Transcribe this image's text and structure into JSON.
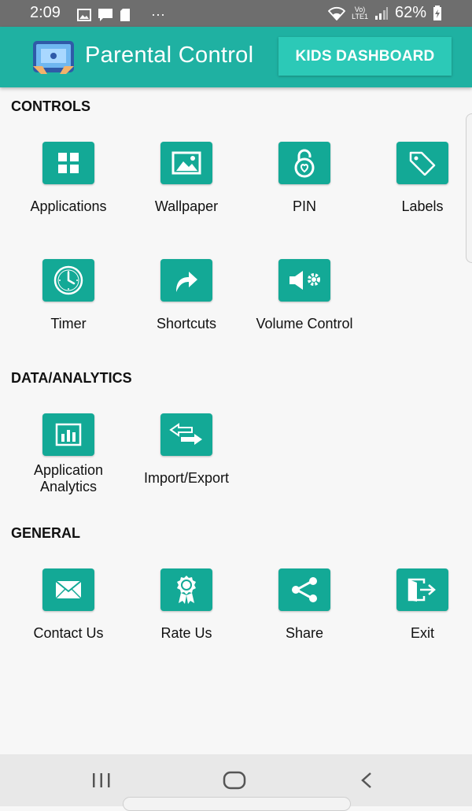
{
  "status_bar": {
    "time": "2:09",
    "more": "···",
    "network_top": "Vo)",
    "network_bottom": "LTE1",
    "battery": "62%"
  },
  "app_bar": {
    "title": "Parental Control",
    "kids_dashboard_label": "KIDS DASHBOARD"
  },
  "sections": {
    "controls": {
      "title": "CONTROLS",
      "items": [
        {
          "label": "Applications",
          "icon": "grid-icon"
        },
        {
          "label": "Wallpaper",
          "icon": "image-icon"
        },
        {
          "label": "PIN",
          "icon": "lock-icon"
        },
        {
          "label": "Labels",
          "icon": "tag-icon"
        },
        {
          "label": "Timer",
          "icon": "clock-icon"
        },
        {
          "label": "Shortcuts",
          "icon": "shortcut-arrow-icon"
        },
        {
          "label": "Volume Control",
          "icon": "volume-settings-icon"
        }
      ]
    },
    "analytics": {
      "title": "DATA/ANALYTICS",
      "items": [
        {
          "label": "Application\nAnalytics",
          "icon": "bar-chart-icon"
        },
        {
          "label": "Import/Export",
          "icon": "swap-arrows-icon"
        }
      ]
    },
    "general": {
      "title": "GENERAL",
      "items": [
        {
          "label": "Contact Us",
          "icon": "envelope-icon"
        },
        {
          "label": "Rate Us",
          "icon": "award-icon"
        },
        {
          "label": "Share",
          "icon": "share-icon"
        },
        {
          "label": "Exit",
          "icon": "exit-icon"
        }
      ]
    }
  },
  "colors": {
    "app_bar": "#1fb1a2",
    "button": "#2cc9b7",
    "tile": "#13a996"
  },
  "nav_bar": {
    "icons": [
      "recents-icon",
      "home-icon",
      "back-icon"
    ]
  }
}
